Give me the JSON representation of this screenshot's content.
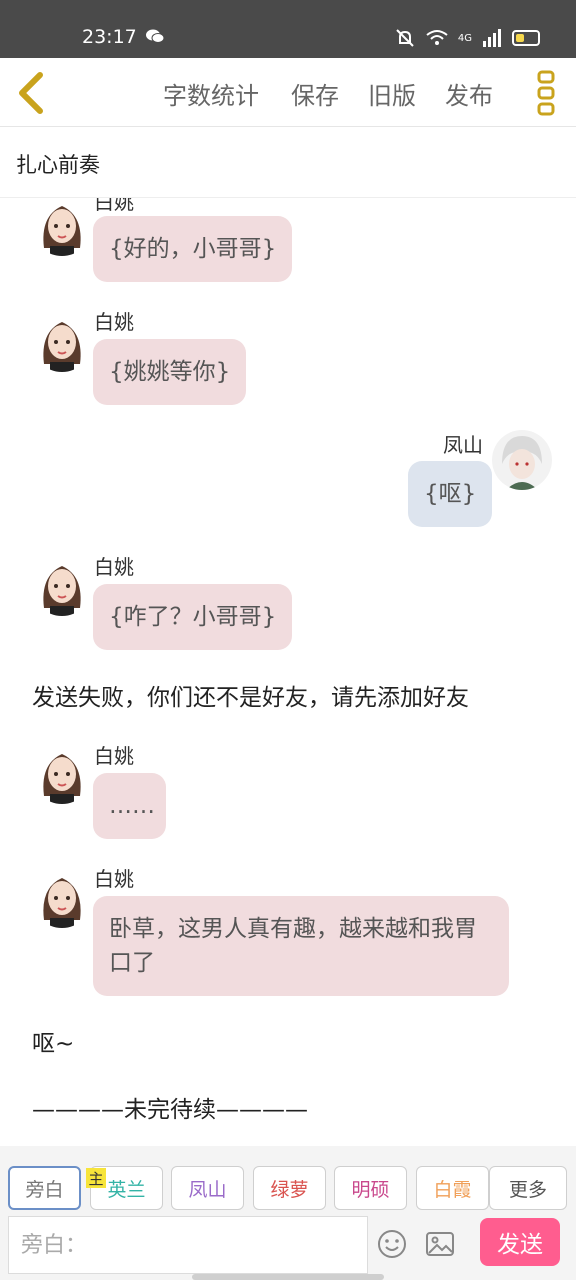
{
  "status": {
    "time": "23:17",
    "network": "4G"
  },
  "nav": {
    "word_count": "字数统计",
    "save": "保存",
    "old_version": "旧版",
    "publish": "发布"
  },
  "doc_title": "扎心前奏",
  "messages": {
    "m0": {
      "name": "白姚",
      "text": "{好的，小哥哥}"
    },
    "m1": {
      "name": "白姚",
      "text": "{姚姚等你}"
    },
    "m2": {
      "name": "凤山",
      "text": "{呕}"
    },
    "m3": {
      "name": "白姚",
      "text": "{咋了？小哥哥}"
    },
    "m4": {
      "text": "发送失败，你们还不是好友，请先添加好友"
    },
    "m5": {
      "name": "白姚",
      "text": "……"
    },
    "m6": {
      "name": "白姚",
      "text": "卧草，这男人真有趣，越来越和我胃口了"
    },
    "m7": {
      "text": "呕~"
    },
    "m8": {
      "text": "————未完待续————"
    }
  },
  "roles": [
    {
      "label": "旁白",
      "color": "#777777"
    },
    {
      "label": "英兰",
      "color": "#34b3a6"
    },
    {
      "label": "凤山",
      "color": "#9a6bc9"
    },
    {
      "label": "绿萝",
      "color": "#d9534f"
    },
    {
      "label": "明硕",
      "color": "#c9488c"
    },
    {
      "label": "白霞",
      "color": "#f0a05a"
    },
    {
      "label": "更多",
      "color": "#555555"
    }
  ],
  "main_tag": "主",
  "input": {
    "placeholder": "旁白："
  },
  "send_label": "发送"
}
